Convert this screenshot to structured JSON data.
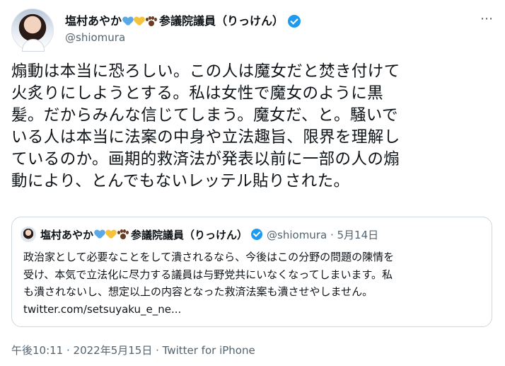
{
  "author": {
    "display_name": "塩村あやか",
    "title": "参議院議員（りっけん）",
    "handle": "@shiomura",
    "colors": {
      "heart_blue": "#5aa9e6",
      "heart_yellow": "#f5c33b",
      "verified": "#1d9bf0"
    }
  },
  "tweet": {
    "lines": [
      "煽動は本当に恐ろしい。この人は魔女だと焚き付けて",
      "火炙りにしようとする。私は女性で魔女のように黒",
      "髪。だからみんな信じてしまう。魔女だ、と。騒いで",
      "いる人は本当に法案の中身や立法趣旨、限界を理解し",
      "ているのか。画期的救済法が発表以前に一部の人の煽",
      "動により、とんでもないレッテル貼りされた。"
    ],
    "timestamp": "午後10:11 · 2022年5月15日 · Twitter for iPhone"
  },
  "quoted_tweet": {
    "display_name": "塩村あやか",
    "title": "参議院議員（りっけん）",
    "meta": "@shiomura · 5月14日",
    "lines": [
      "政治家として必要なことをして潰されるなら、今後はこの分野の問題の陳情を",
      "受け、本気で立法化に尽力する議員は与野党共にいなくなってしまいます。私",
      "も潰されないし、想定以上の内容となった救済法案も潰させやしません。",
      "twitter.com/setsuyaku_e_ne..."
    ]
  }
}
